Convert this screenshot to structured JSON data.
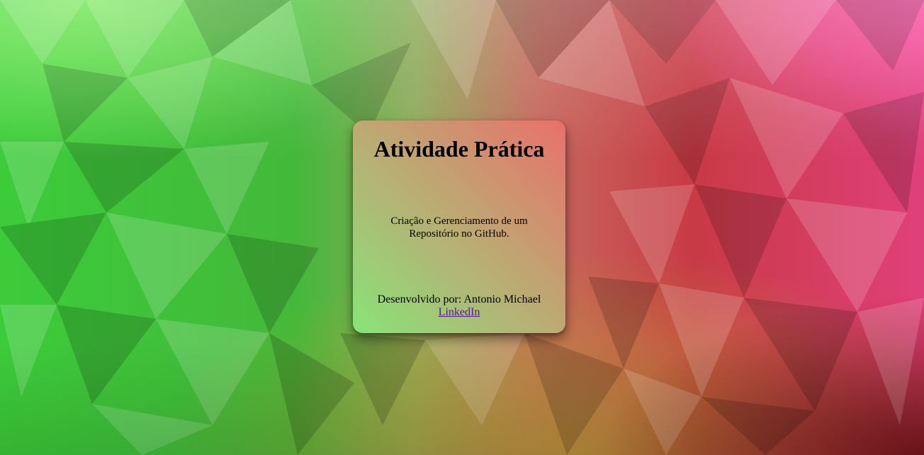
{
  "card": {
    "title": "Atividade Prática",
    "description": "Criação e Gerenciamento de um Repositório no GitHub.",
    "footer": {
      "developed_by": "Desenvolvido por: Antonio Michael",
      "link_label": "LinkedIn"
    }
  },
  "colors": {
    "background_left": "#3ecf3a",
    "background_center": "#b3a95e",
    "background_right": "#e8468f",
    "background_bottom_right": "#7a1a18",
    "card_gradient_start": "#88e478",
    "card_gradient_end": "#e9706a",
    "link": "#551a8b"
  }
}
